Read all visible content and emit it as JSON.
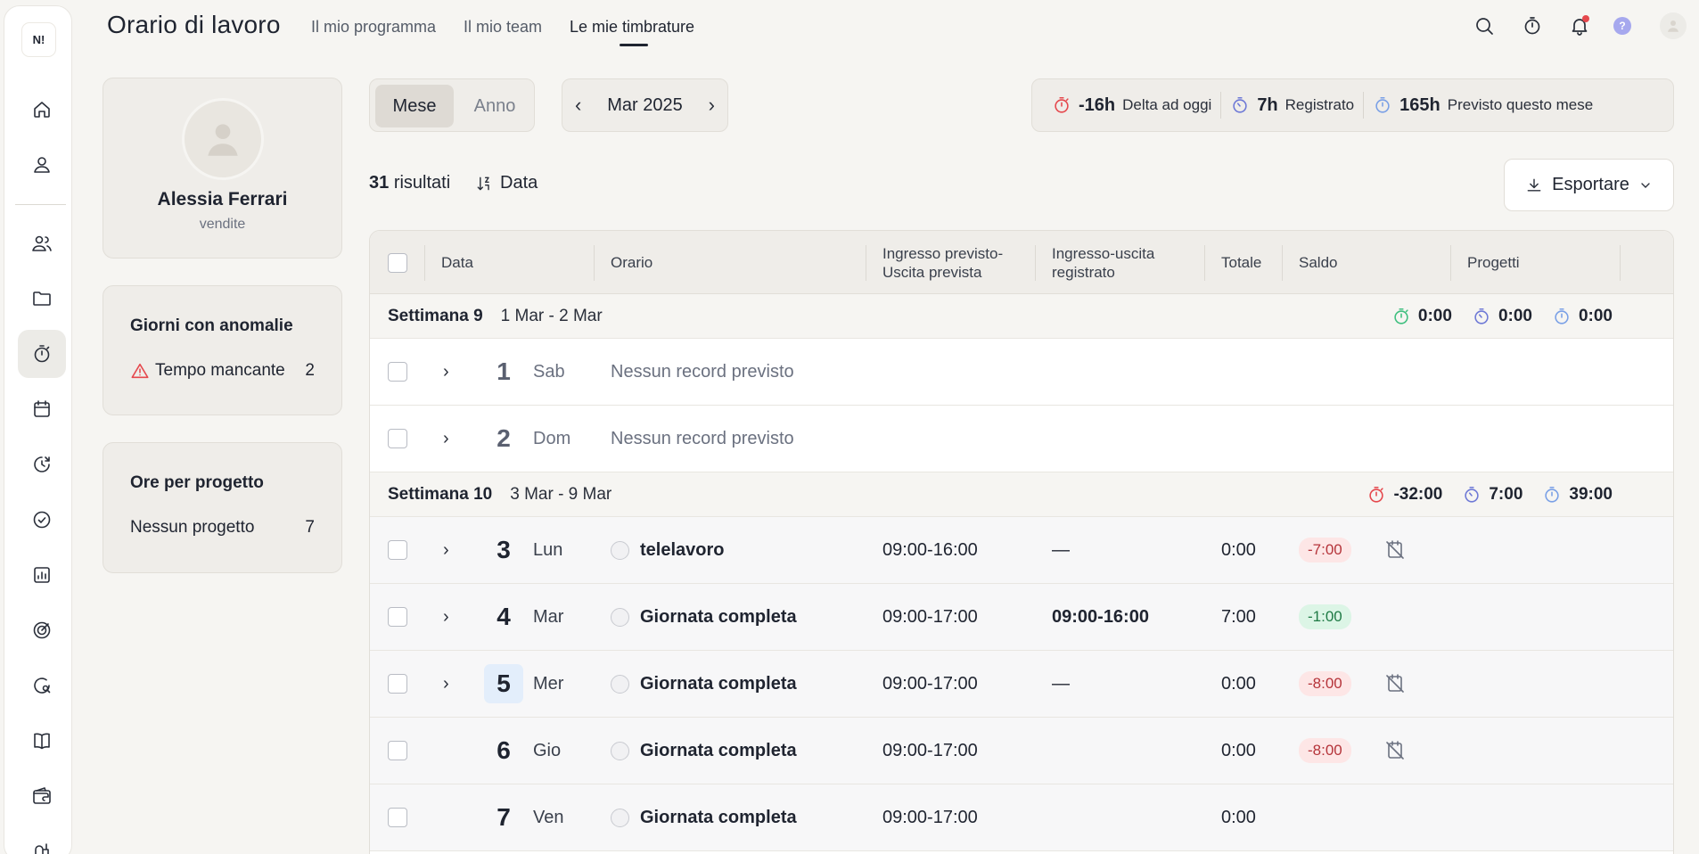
{
  "rail": {
    "logo": "N!",
    "items": [
      {
        "icon": "home-icon"
      },
      {
        "icon": "user-icon"
      },
      {
        "icon": "team-icon"
      },
      {
        "icon": "folder-icon"
      },
      {
        "icon": "stopwatch-icon",
        "active": true
      },
      {
        "icon": "calendar-icon"
      },
      {
        "icon": "clock-chart-icon"
      },
      {
        "icon": "check-circle-icon"
      },
      {
        "icon": "analytics-icon"
      },
      {
        "icon": "target-icon"
      },
      {
        "icon": "chat-search-icon"
      },
      {
        "icon": "book-icon"
      },
      {
        "icon": "wallet-icon"
      },
      {
        "icon": "mailbox-icon"
      }
    ]
  },
  "header": {
    "title": "Orario di lavoro",
    "tabs": [
      {
        "label": "Il mio programma"
      },
      {
        "label": "Il mio team"
      },
      {
        "label": "Le mie timbrature",
        "active": true
      }
    ],
    "help_label": "?"
  },
  "profile": {
    "name": "Alessia Ferrari",
    "role": "vendite"
  },
  "anomalies": {
    "title": "Giorni con anomalie",
    "label": "Tempo mancante",
    "count": "2"
  },
  "projects": {
    "title": "Ore per progetto",
    "label": "Nessun progetto",
    "count": "7"
  },
  "toolbar": {
    "view_month": "Mese",
    "view_year": "Anno",
    "period": "Mar 2025",
    "prev": "‹",
    "next": "›",
    "delta_value": "-16h",
    "delta_label": "Delta ad oggi",
    "registered_value": "7h",
    "registered_label": "Registrato",
    "planned_value": "165h",
    "planned_label": "Previsto questo mese",
    "results_count": "31",
    "results_label": "risultati",
    "sort_label": "Data",
    "export_label": "Esportare"
  },
  "table": {
    "headers": {
      "date": "Data",
      "schedule": "Orario",
      "planned_1": "Ingresso previsto-",
      "planned_2": "Uscita prevista",
      "recorded_1": "Ingresso-uscita",
      "recorded_2": "registrato",
      "total": "Totale",
      "balance": "Saldo",
      "projects": "Progetti"
    },
    "weeks": [
      {
        "title": "Settimana 9",
        "range": "1 Mar - 2 Mar",
        "delta": "0:00",
        "registered": "0:00",
        "planned": "0:00"
      },
      {
        "title": "Settimana 10",
        "range": "3 Mar - 9 Mar",
        "delta": "-32:00",
        "registered": "7:00",
        "planned": "39:00"
      }
    ],
    "days": [
      {
        "num": "1",
        "name": "Sab",
        "note": "Nessun record previsto"
      },
      {
        "num": "2",
        "name": "Dom",
        "note": "Nessun record previsto"
      },
      {
        "num": "3",
        "name": "Lun",
        "schedule": "telelavoro",
        "planned": "09:00-16:00",
        "recorded": "—",
        "total": "0:00",
        "balance": "-7:00"
      },
      {
        "num": "4",
        "name": "Mar",
        "schedule": "Giornata completa",
        "planned": "09:00-17:00",
        "recorded": "09:00-16:00",
        "total": "7:00",
        "balance": "-1:00"
      },
      {
        "num": "5",
        "name": "Mer",
        "schedule": "Giornata completa",
        "planned": "09:00-17:00",
        "recorded": "—",
        "total": "0:00",
        "balance": "-8:00"
      },
      {
        "num": "6",
        "name": "Gio",
        "schedule": "Giornata completa",
        "planned": "09:00-17:00",
        "recorded": "",
        "total": "0:00",
        "balance": "-8:00"
      },
      {
        "num": "7",
        "name": "Ven",
        "schedule": "Giornata completa",
        "planned": "09:00-17:00",
        "recorded": "",
        "total": "0:00",
        "balance": ""
      }
    ]
  },
  "colors": {
    "delta": "#e5484d",
    "registered": "#6e79d6",
    "planned": "#7aa0e6",
    "week9_delta": "#3fbf7f"
  }
}
